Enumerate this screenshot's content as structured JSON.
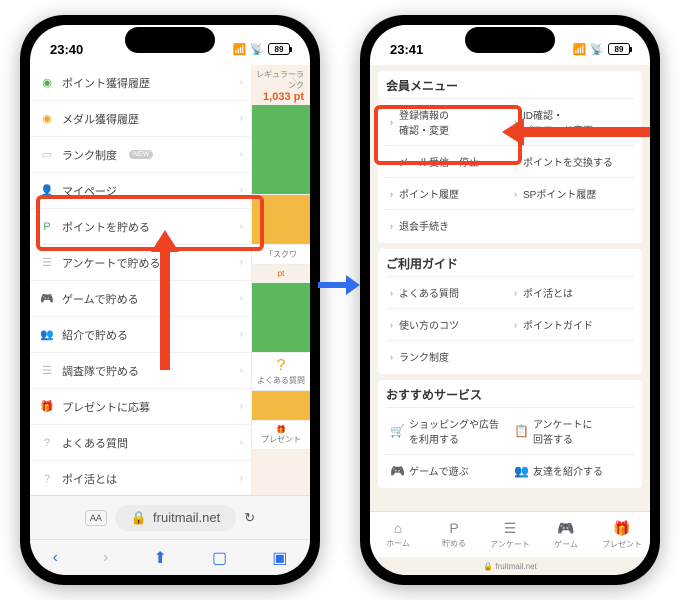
{
  "status": {
    "time_left": "23:40",
    "time_right": "23:41",
    "signal": "􀙇",
    "wifi": "􀙈",
    "batt": "89"
  },
  "left": {
    "rank_label": "レギュラーランク",
    "rank_pt": "1,033 pt",
    "menu": [
      {
        "label": "ポイント獲得履歴",
        "icon": "◉",
        "cls": "ic-green"
      },
      {
        "label": "メダル獲得履歴",
        "icon": "◉",
        "cls": "ic-orange"
      },
      {
        "label": "ランク制度",
        "icon": "▭",
        "cls": "ic-grey",
        "new": "NEW"
      },
      {
        "label": "マイページ",
        "icon": "👤",
        "cls": "ic-grey"
      },
      {
        "label": "ポイントを貯める",
        "icon": "P",
        "cls": "ic-green"
      },
      {
        "label": "アンケートで貯める",
        "icon": "☰",
        "cls": "ic-grey"
      },
      {
        "label": "ゲームで貯める",
        "icon": "🎮",
        "cls": "ic-grey"
      },
      {
        "label": "紹介で貯める",
        "icon": "👥",
        "cls": "ic-grey"
      },
      {
        "label": "調査隊で貯める",
        "icon": "☰",
        "cls": "ic-grey"
      },
      {
        "label": "プレゼントに応募",
        "icon": "🎁",
        "cls": "ic-grey"
      },
      {
        "label": "よくある質問",
        "icon": "?",
        "cls": "ic-grey"
      },
      {
        "label": "ポイ活とは",
        "icon": "?",
        "cls": "ic-grey"
      }
    ],
    "side": {
      "sukuwa": "「スクワ",
      "pt": "pt",
      "faq": "よくある質問",
      "present": "プレゼント"
    },
    "url": "fruitmail.net"
  },
  "right": {
    "sec1_title": "会員メニュー",
    "sec1": [
      {
        "a": "登録情報の\n確認・変更",
        "b": "ID確認・\nパスワード変更"
      },
      {
        "a": "メール受信・停止",
        "b": "ポイントを交換する"
      },
      {
        "a": "ポイント履歴",
        "b": "SPポイント履歴"
      },
      {
        "a": "退会手続き",
        "b": ""
      }
    ],
    "sec2_title": "ご利用ガイド",
    "sec2": [
      {
        "a": "よくある質問",
        "b": "ポイ活とは"
      },
      {
        "a": "使い方のコツ",
        "b": "ポイントガイド"
      },
      {
        "a": "ランク制度",
        "b": ""
      }
    ],
    "sec3_title": "おすすめサービス",
    "sec3": [
      {
        "a": "ショッピングや広告\nを利用する",
        "ia": "🛒",
        "b": "アンケートに\n回答する",
        "ib": "📋"
      },
      {
        "a": "ゲームで遊ぶ",
        "ia": "🎮",
        "b": "友達を紹介する",
        "ib": "👥"
      }
    ],
    "nav": [
      {
        "label": "ホーム",
        "icon": "⌂"
      },
      {
        "label": "貯める",
        "icon": "P"
      },
      {
        "label": "アンケート",
        "icon": "☰"
      },
      {
        "label": "ゲーム",
        "icon": "🎮"
      },
      {
        "label": "プレゼント",
        "icon": "🎁"
      }
    ],
    "url": "fruitmail.net"
  }
}
